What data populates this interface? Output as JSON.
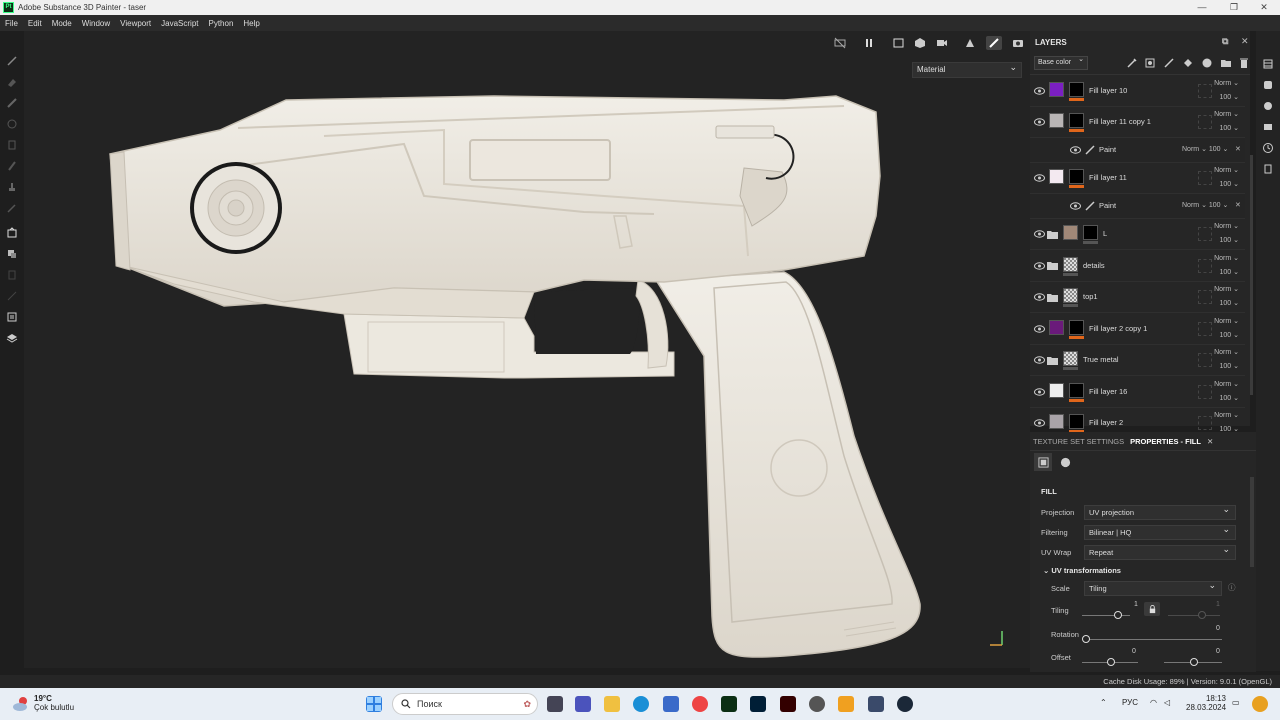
{
  "window": {
    "title": "Adobe Substance 3D Painter - taser"
  },
  "menu": [
    "File",
    "Edit",
    "Mode",
    "Window",
    "Viewport",
    "JavaScript",
    "Python",
    "Help"
  ],
  "viewport": {
    "material_select": "Material"
  },
  "layers": {
    "title": "LAYERS",
    "channel_select": "Base color",
    "items": [
      {
        "name": "Fill layer 10",
        "blend": "Norm",
        "opacity": "100",
        "thumb": "#7b1fc2"
      },
      {
        "name": "Fill layer 11 copy 1",
        "blend": "Norm",
        "opacity": "100",
        "thumb": "#b9b5b5"
      },
      {
        "name": "Paint",
        "blend": "Norm",
        "opacity": "100",
        "sub": true
      },
      {
        "name": "Fill layer 11",
        "blend": "Norm",
        "opacity": "100",
        "thumb": "#f3e9f0"
      },
      {
        "name": "Paint",
        "blend": "Norm",
        "opacity": "100",
        "sub": true
      },
      {
        "name": "L",
        "blend": "Norm",
        "opacity": "100",
        "thumb": "#a08878",
        "folder": true
      },
      {
        "name": "details",
        "blend": "Norm",
        "opacity": "100",
        "folder": true
      },
      {
        "name": "top1",
        "blend": "Norm",
        "opacity": "100",
        "folder": true
      },
      {
        "name": "Fill layer 2 copy 1",
        "blend": "Norm",
        "opacity": "100",
        "thumb": "#6a1a7a"
      },
      {
        "name": "True metal",
        "blend": "Norm",
        "opacity": "100",
        "folder": true
      },
      {
        "name": "Fill layer 16",
        "blend": "Norm",
        "opacity": "100",
        "thumb": "#eeeeee"
      },
      {
        "name": "Fill layer 2",
        "blend": "Norm",
        "opacity": "100",
        "thumb": "#a9a3a8"
      }
    ]
  },
  "properties": {
    "tab_texture": "TEXTURE SET SETTINGS",
    "tab_props": "PROPERTIES - FILL",
    "section": "FILL",
    "projection_label": "Projection",
    "projection": "UV projection",
    "filtering_label": "Filtering",
    "filtering": "Bilinear | HQ",
    "uvwrap_label": "UV Wrap",
    "uvwrap": "Repeat",
    "uvtrans": "UV transformations",
    "scale_label": "Scale",
    "scale": "Tiling",
    "tiling_label": "Tiling",
    "tiling_val": "1",
    "tiling_val2": "1",
    "rotation_label": "Rotation",
    "rotation_val": "0",
    "offset_label": "Offset",
    "offset_val1": "0",
    "offset_val2": "0"
  },
  "status": {
    "text": "Cache Disk Usage:   89% | Version: 9.0.1 (OpenGL)"
  },
  "taskbar": {
    "temp": "19°C",
    "weather": "Çok bulutlu",
    "search": "Поиск",
    "lang": "РУС",
    "time": "18:13",
    "date": "28.03.2024"
  },
  "colors": {
    "accent": "#e0661b",
    "panel": "#262626",
    "viewport": "#232323"
  }
}
